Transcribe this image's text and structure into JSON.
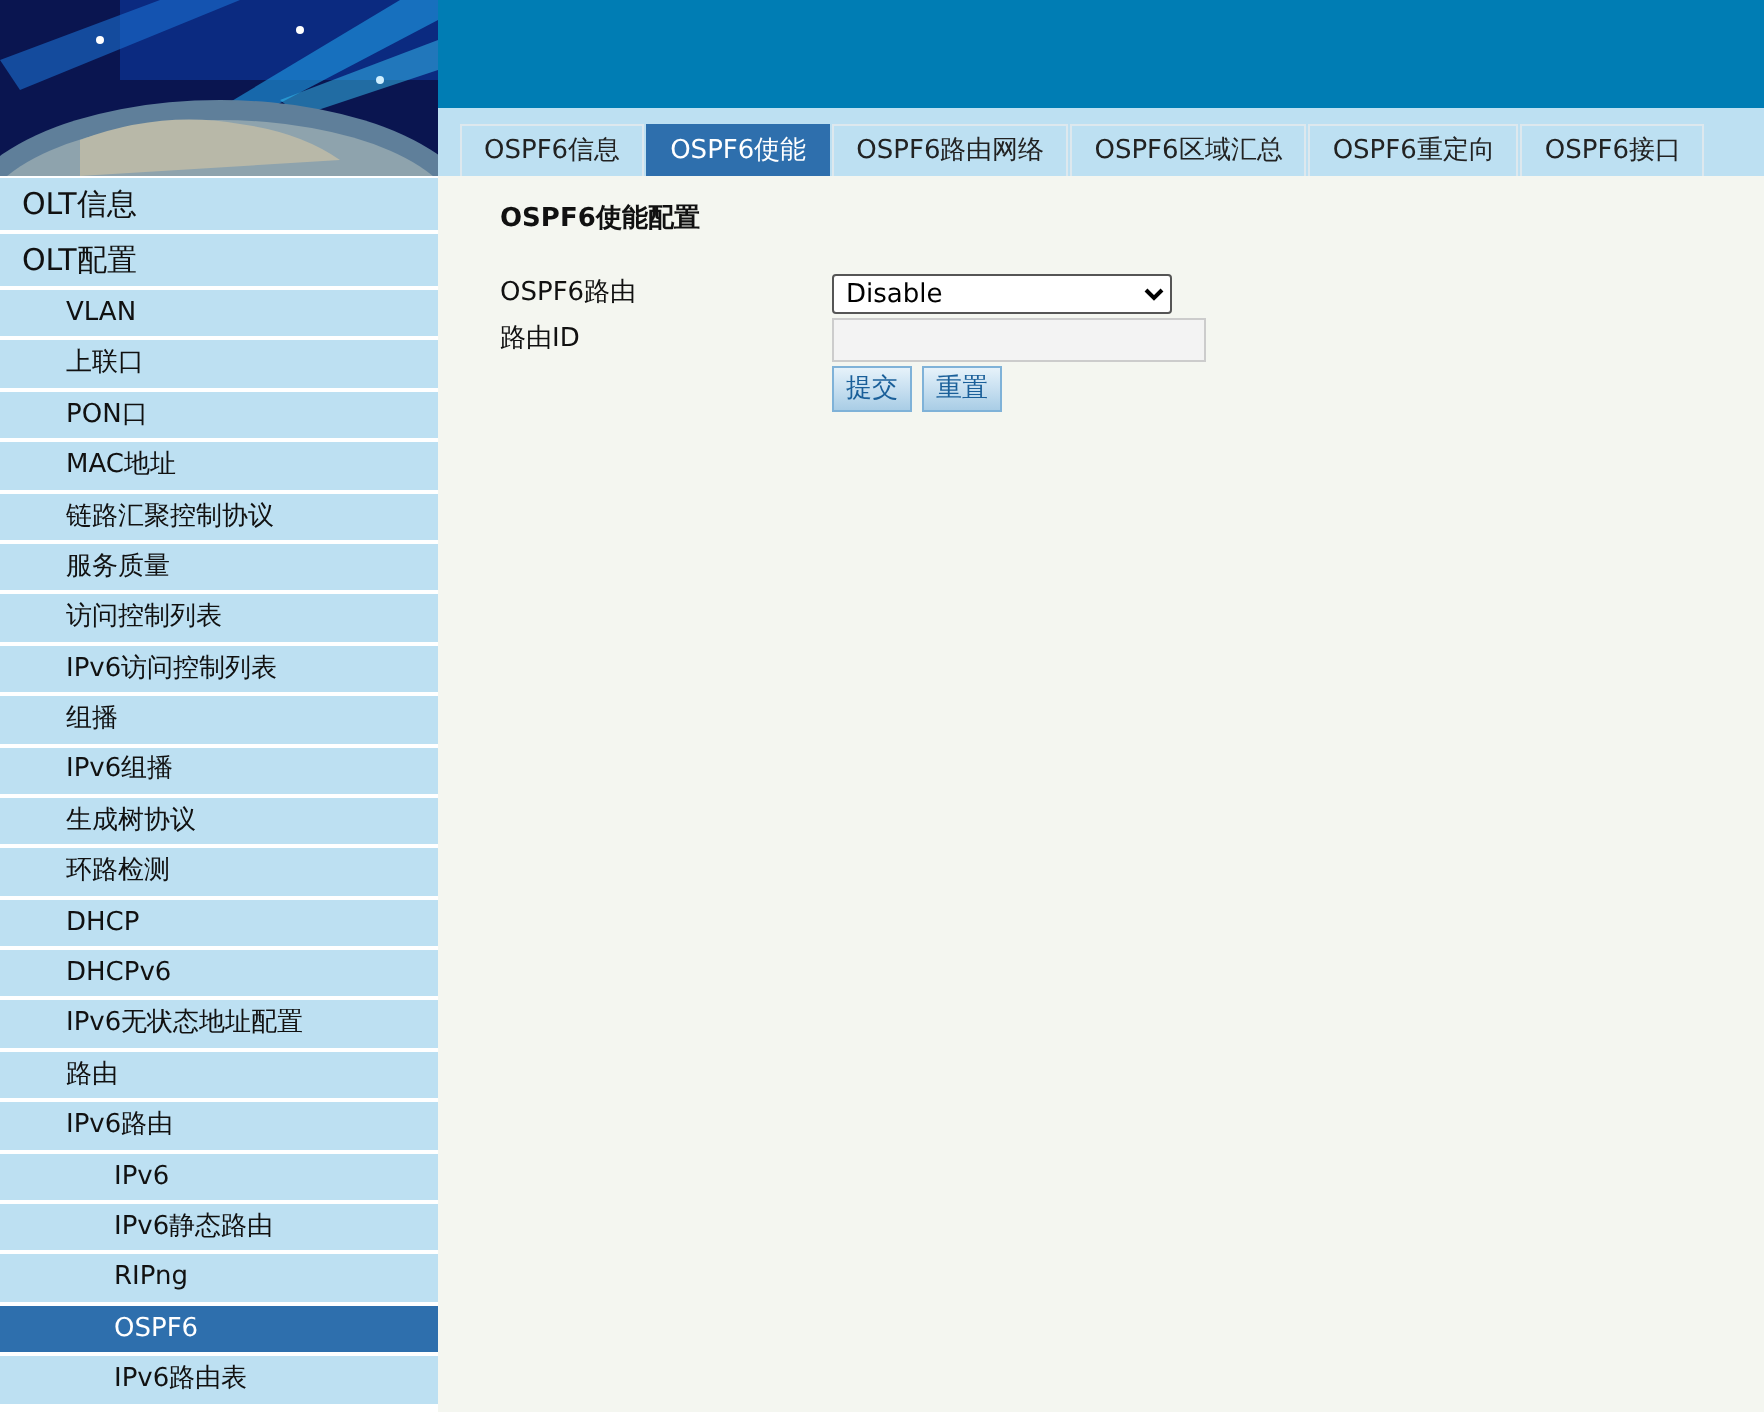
{
  "tabs": [
    {
      "label": "OSPF6信息",
      "selected": false
    },
    {
      "label": "OSPF6使能",
      "selected": true
    },
    {
      "label": "OSPF6路由网络",
      "selected": false
    },
    {
      "label": "OSPF6区域汇总",
      "selected": false
    },
    {
      "label": "OSPF6重定向",
      "selected": false
    },
    {
      "label": "OSPF6接口",
      "selected": false
    }
  ],
  "sidebar": {
    "items": [
      {
        "label": "OLT信息",
        "selected": false
      },
      {
        "label": "OLT配置",
        "selected": false,
        "children": [
          {
            "label": "VLAN",
            "selected": false
          },
          {
            "label": "上联口",
            "selected": false
          },
          {
            "label": "PON口",
            "selected": false
          },
          {
            "label": "MAC地址",
            "selected": false
          },
          {
            "label": "链路汇聚控制协议",
            "selected": false
          },
          {
            "label": "服务质量",
            "selected": false
          },
          {
            "label": "访问控制列表",
            "selected": false
          },
          {
            "label": "IPv6访问控制列表",
            "selected": false
          },
          {
            "label": "组播",
            "selected": false
          },
          {
            "label": "IPv6组播",
            "selected": false
          },
          {
            "label": "生成树协议",
            "selected": false
          },
          {
            "label": "环路检测",
            "selected": false
          },
          {
            "label": "DHCP",
            "selected": false
          },
          {
            "label": "DHCPv6",
            "selected": false
          },
          {
            "label": "IPv6无状态地址配置",
            "selected": false
          },
          {
            "label": "路由",
            "selected": false
          },
          {
            "label": "IPv6路由",
            "selected": false,
            "children": [
              {
                "label": "IPv6",
                "selected": false
              },
              {
                "label": "IPv6静态路由",
                "selected": false
              },
              {
                "label": "RIPng",
                "selected": false
              },
              {
                "label": "OSPF6",
                "selected": true
              },
              {
                "label": "IPv6路由表",
                "selected": false
              }
            ]
          }
        ]
      }
    ]
  },
  "form": {
    "title": "OSPF6使能配置",
    "fields": [
      {
        "kind": "select",
        "label": "OSPF6路由",
        "value": "Disable"
      },
      {
        "kind": "text",
        "label": "路由ID"
      }
    ],
    "buttons": [
      "提交",
      "重置"
    ]
  }
}
